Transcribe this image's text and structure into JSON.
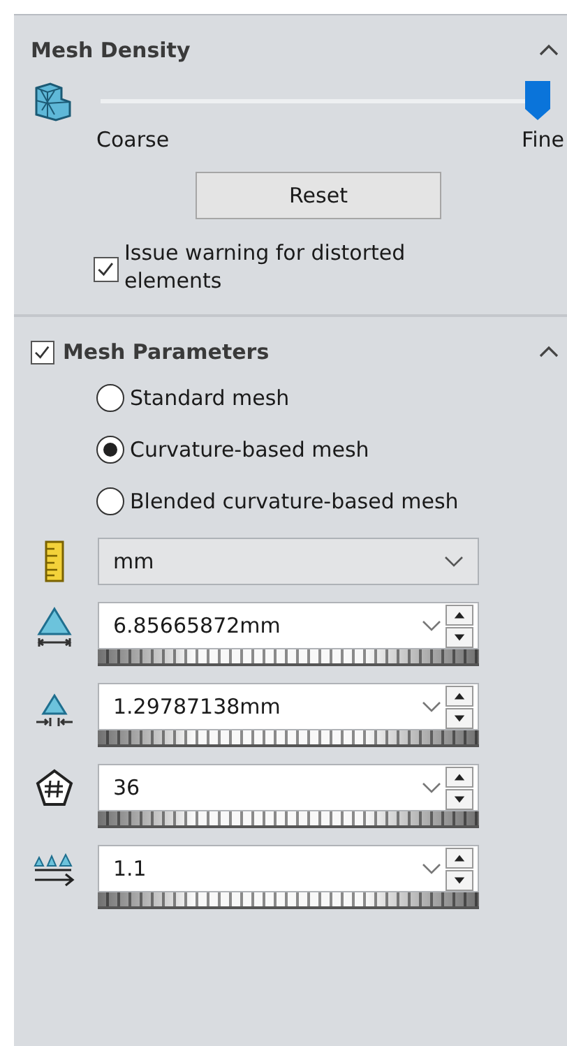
{
  "mesh_density": {
    "title": "Mesh Density",
    "expanded": true,
    "slider": {
      "level": 1
    },
    "min_label": "Coarse",
    "max_label": "Fine",
    "reset_button": "Reset",
    "warning_checkbox": {
      "label": "Issue warning for distorted elements",
      "checked": true
    }
  },
  "mesh_parameters": {
    "title": "Mesh Parameters",
    "checked": true,
    "expanded": true,
    "mesh_types": [
      {
        "label": "Standard mesh",
        "selected": false
      },
      {
        "label": "Curvature-based mesh",
        "selected": true
      },
      {
        "label": "Blended curvature-based mesh",
        "selected": false
      }
    ],
    "unit": "mm",
    "fields": [
      {
        "kind": "max-size",
        "value": "6.85665872mm"
      },
      {
        "kind": "min-size",
        "value": "1.29787138mm"
      },
      {
        "kind": "circle-count",
        "value": "36"
      },
      {
        "kind": "growth-ratio",
        "value": "1.1"
      }
    ]
  }
}
